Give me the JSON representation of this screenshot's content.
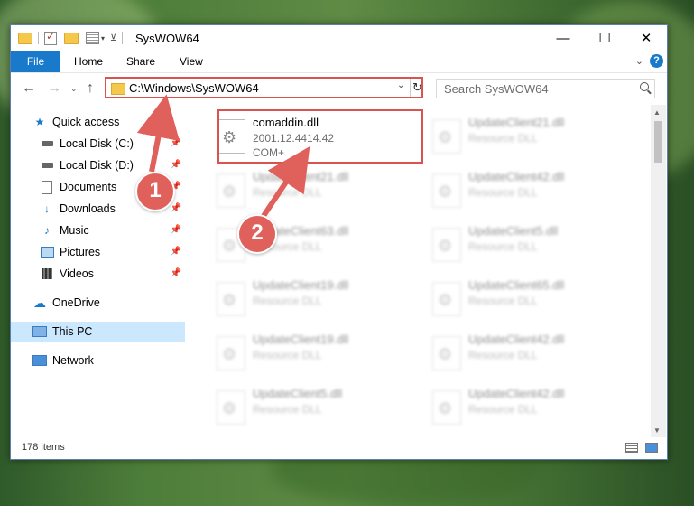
{
  "window": {
    "title": "SysWOW64",
    "controls": {
      "minimize": "—",
      "maximize": "☐",
      "close": "✕"
    }
  },
  "ribbon": {
    "tabs": [
      "File",
      "Home",
      "Share",
      "View"
    ],
    "help": "?"
  },
  "address": {
    "path": "C:\\Windows\\SysWOW64",
    "search_placeholder": "Search SysWOW64"
  },
  "sidebar": {
    "items": [
      {
        "label": "Quick access",
        "icon": "star-icon"
      },
      {
        "label": "Local Disk (C:)",
        "icon": "drive-icon",
        "pinned": true
      },
      {
        "label": "Local Disk (D:)",
        "icon": "drive-icon",
        "pinned": true
      },
      {
        "label": "Documents",
        "icon": "document-icon",
        "pinned": true
      },
      {
        "label": "Downloads",
        "icon": "download-icon",
        "pinned": true
      },
      {
        "label": "Music",
        "icon": "music-icon",
        "pinned": true
      },
      {
        "label": "Pictures",
        "icon": "picture-icon",
        "pinned": true
      },
      {
        "label": "Videos",
        "icon": "video-icon",
        "pinned": true
      },
      {
        "label": "OneDrive",
        "icon": "cloud-icon"
      },
      {
        "label": "This PC",
        "icon": "computer-icon",
        "selected": true
      },
      {
        "label": "Network",
        "icon": "network-icon"
      }
    ]
  },
  "files": {
    "highlighted": {
      "name": "comaddin.dll",
      "version": "2001.12.4414.42",
      "type": "COM+"
    },
    "left_col": [
      {
        "name": "UpdateClient21.dll",
        "type": "Resource DLL"
      },
      {
        "name": "UpdateClient63.dll",
        "type": "Resource DLL"
      },
      {
        "name": "UpdateClient19.dll",
        "type": "Resource DLL"
      },
      {
        "name": "UpdateClient19.dll",
        "type": "Resource DLL"
      },
      {
        "name": "UpdateClient5.dll",
        "type": "Resource DLL"
      }
    ],
    "right_col": [
      {
        "name": "UpdateClient21.dll",
        "type": "Resource DLL"
      },
      {
        "name": "UpdateClient42.dll",
        "type": "Resource DLL"
      },
      {
        "name": "UpdateClient5.dll",
        "type": "Resource DLL"
      },
      {
        "name": "UpdateClient65.dll",
        "type": "Resource DLL"
      },
      {
        "name": "UpdateClient42.dll",
        "type": "Resource DLL"
      },
      {
        "name": "UpdateClient42.dll",
        "type": "Resource DLL"
      }
    ]
  },
  "status": {
    "items_count": "178 items"
  },
  "callouts": [
    "1",
    "2"
  ],
  "colors": {
    "accent": "#1979ca",
    "highlight": "#d9534f",
    "selected": "#cce8ff"
  }
}
